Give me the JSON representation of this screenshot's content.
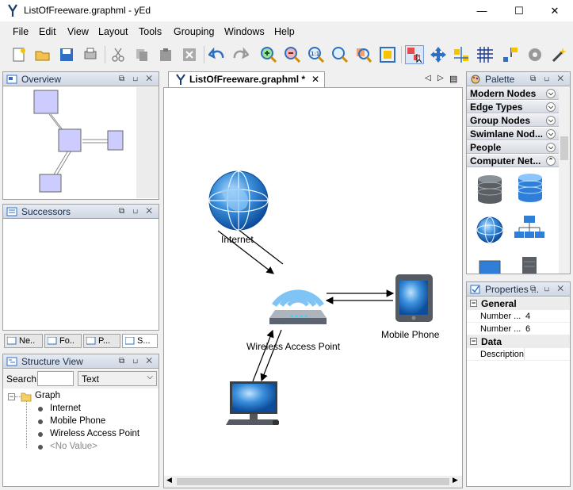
{
  "window": {
    "title": "ListOfFreeware.graphml - yEd",
    "min": "—",
    "max": "☐",
    "close": "✕"
  },
  "menu": [
    "File",
    "Edit",
    "View",
    "Layout",
    "Tools",
    "Grouping",
    "Windows",
    "Help"
  ],
  "overview": {
    "title": "Overview"
  },
  "successors": {
    "title": "Successors"
  },
  "side_tabs": [
    "Ne..",
    "Fo..",
    "P...",
    "S..."
  ],
  "structure": {
    "title": "Structure View",
    "search_label": "Search",
    "search_value": "",
    "filter_value": "Text",
    "root": "Graph",
    "items": [
      "Internet",
      "Mobile Phone",
      "Wireless Access Point",
      "<No Value>"
    ]
  },
  "editor": {
    "tab": "ListOfFreeware.graphml *"
  },
  "graph": {
    "nodes": {
      "internet": "Internet",
      "wap": "Wireless Access Point",
      "mobile": "Mobile Phone"
    }
  },
  "palette": {
    "title": "Palette",
    "categories": [
      "Modern Nodes",
      "Edge Types",
      "Group Nodes",
      "Swimlane Nod...",
      "People",
      "Computer Net..."
    ]
  },
  "properties": {
    "title": "Properties ...",
    "sections": {
      "general": "General",
      "data": "Data"
    },
    "rows": [
      {
        "label": "Number ...",
        "value": "4"
      },
      {
        "label": "Number ...",
        "value": "6"
      }
    ],
    "description_label": "Description"
  },
  "colors": {
    "accent": "#4a90d9",
    "node_fill": "#ccccff",
    "panel_header": "#d6dde8"
  }
}
